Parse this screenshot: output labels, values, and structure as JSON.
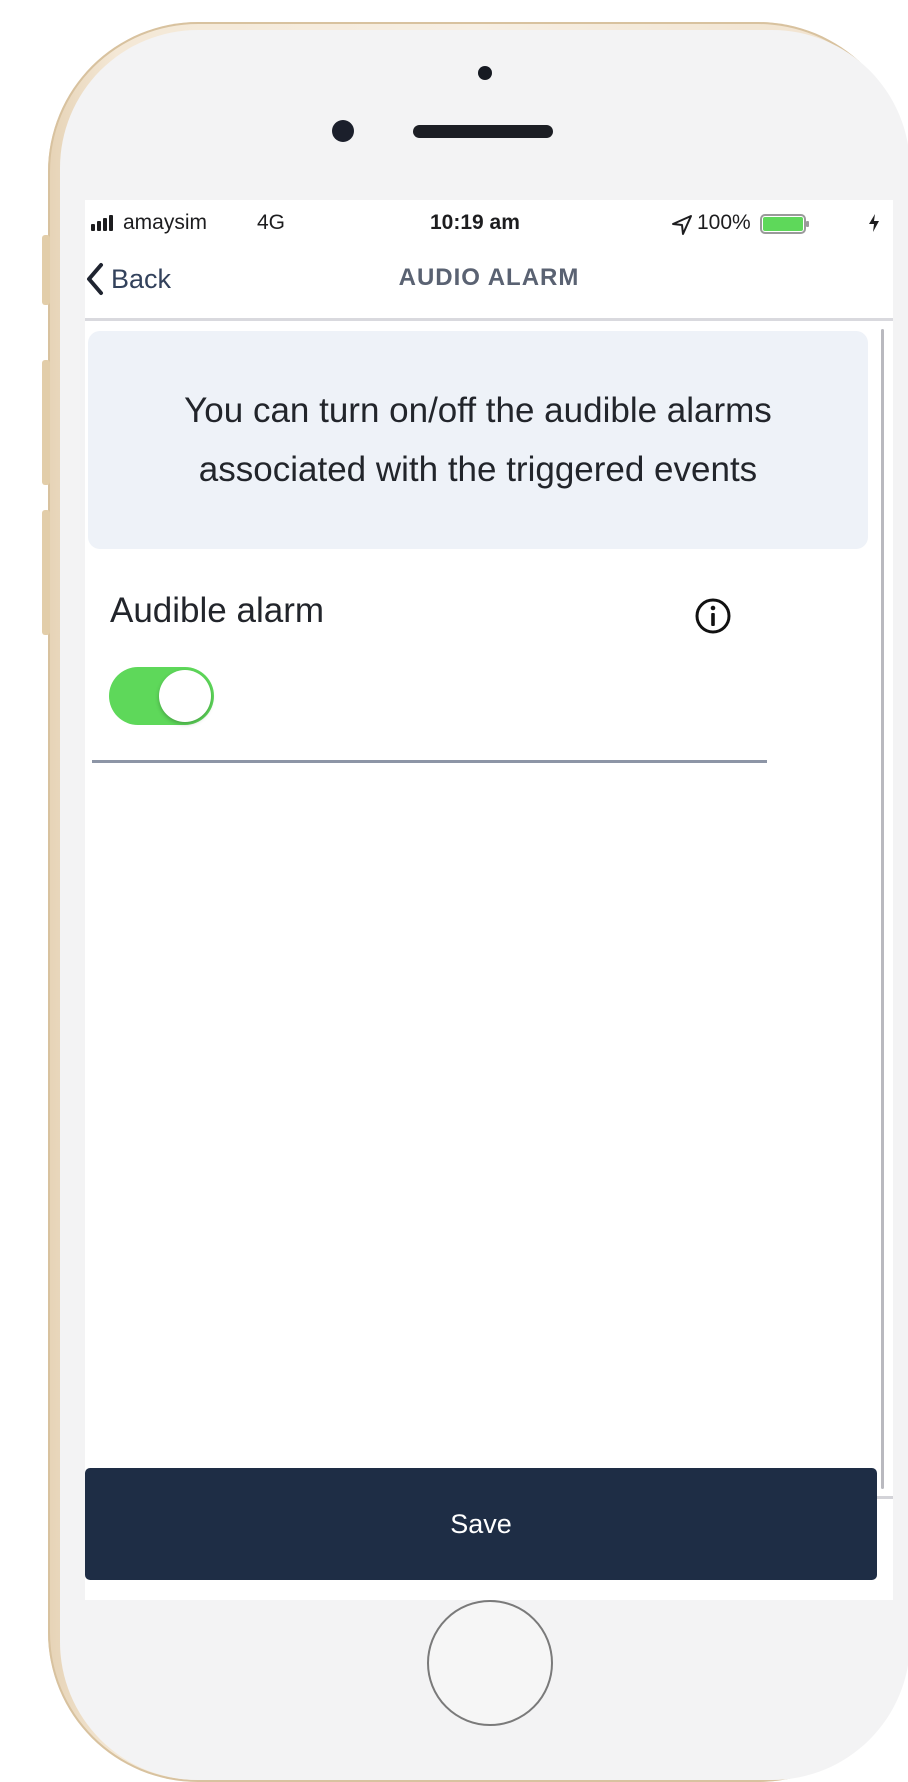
{
  "status_bar": {
    "carrier": "amaysim",
    "network": "4G",
    "time": "10:19 am",
    "battery_percent": "100%",
    "battery_level": 1.0,
    "icons": [
      "signal-icon",
      "location-arrow-icon",
      "battery-icon",
      "charging-icon"
    ]
  },
  "nav": {
    "back_label": "Back",
    "title": "AUDIO ALARM"
  },
  "info_banner": {
    "text": "You can turn on/off the audible alarms associated with the triggered events"
  },
  "setting": {
    "label": "Audible alarm",
    "toggle_on": true,
    "info_icon": "info-circle-icon"
  },
  "footer": {
    "save_label": "Save"
  },
  "colors": {
    "primary_dark": "#1e2d45",
    "toggle_on": "#5ed85a",
    "banner_bg": "#eef2f8",
    "battery_fill": "#5ed85a"
  }
}
